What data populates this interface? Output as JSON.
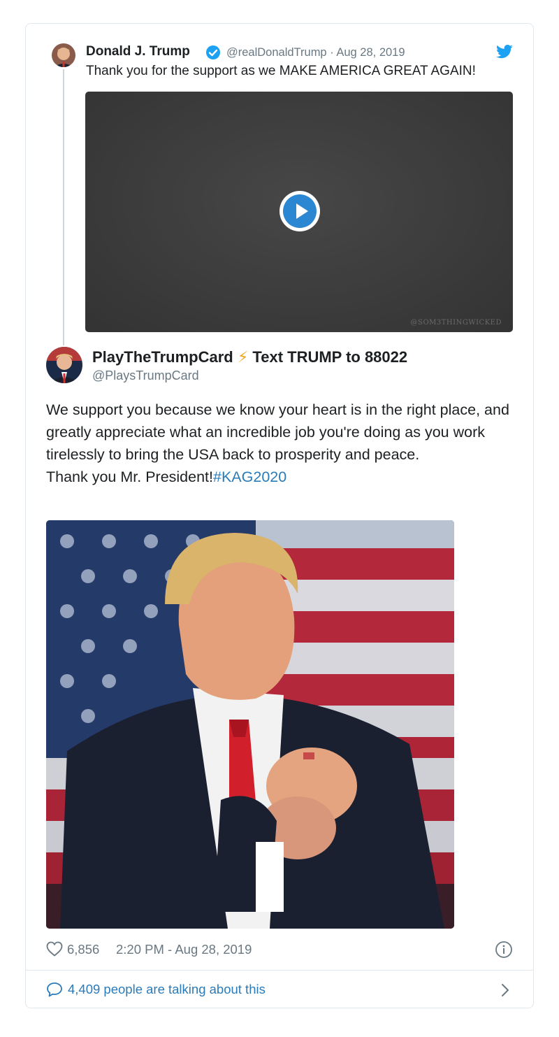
{
  "parent_tweet": {
    "author_name": "Donald J. Trump",
    "handle_date": "@realDonaldTrump · Aug 28, 2019",
    "text": "Thank you for the support as we MAKE AMERICA GREAT AGAIN!",
    "video_watermark": "@SOM3THINGWICKED"
  },
  "quote_tweet": {
    "author_name": "PlayTheTrumpCard",
    "author_emoji": "⚡",
    "author_suffix": "Text TRUMP to 88022",
    "handle": "@PlaysTrumpCard",
    "body_text": "We support you because we know your heart is in the right place, and greatly appreciate what an incredible job you're doing as you work tirelessly to bring the USA back to prosperity and peace.",
    "closing_text": "Thank you Mr. President!",
    "hashtag": "#KAG2020"
  },
  "meta": {
    "likes": "6,856",
    "timestamp": "2:20 PM - Aug 28, 2019"
  },
  "footer": {
    "talking_text": "4,409 people are talking about this"
  },
  "colors": {
    "link": "#2b7bb9",
    "twitter_blue": "#1da1f2",
    "secondary_text": "#697882",
    "border": "#e1e8ed"
  }
}
